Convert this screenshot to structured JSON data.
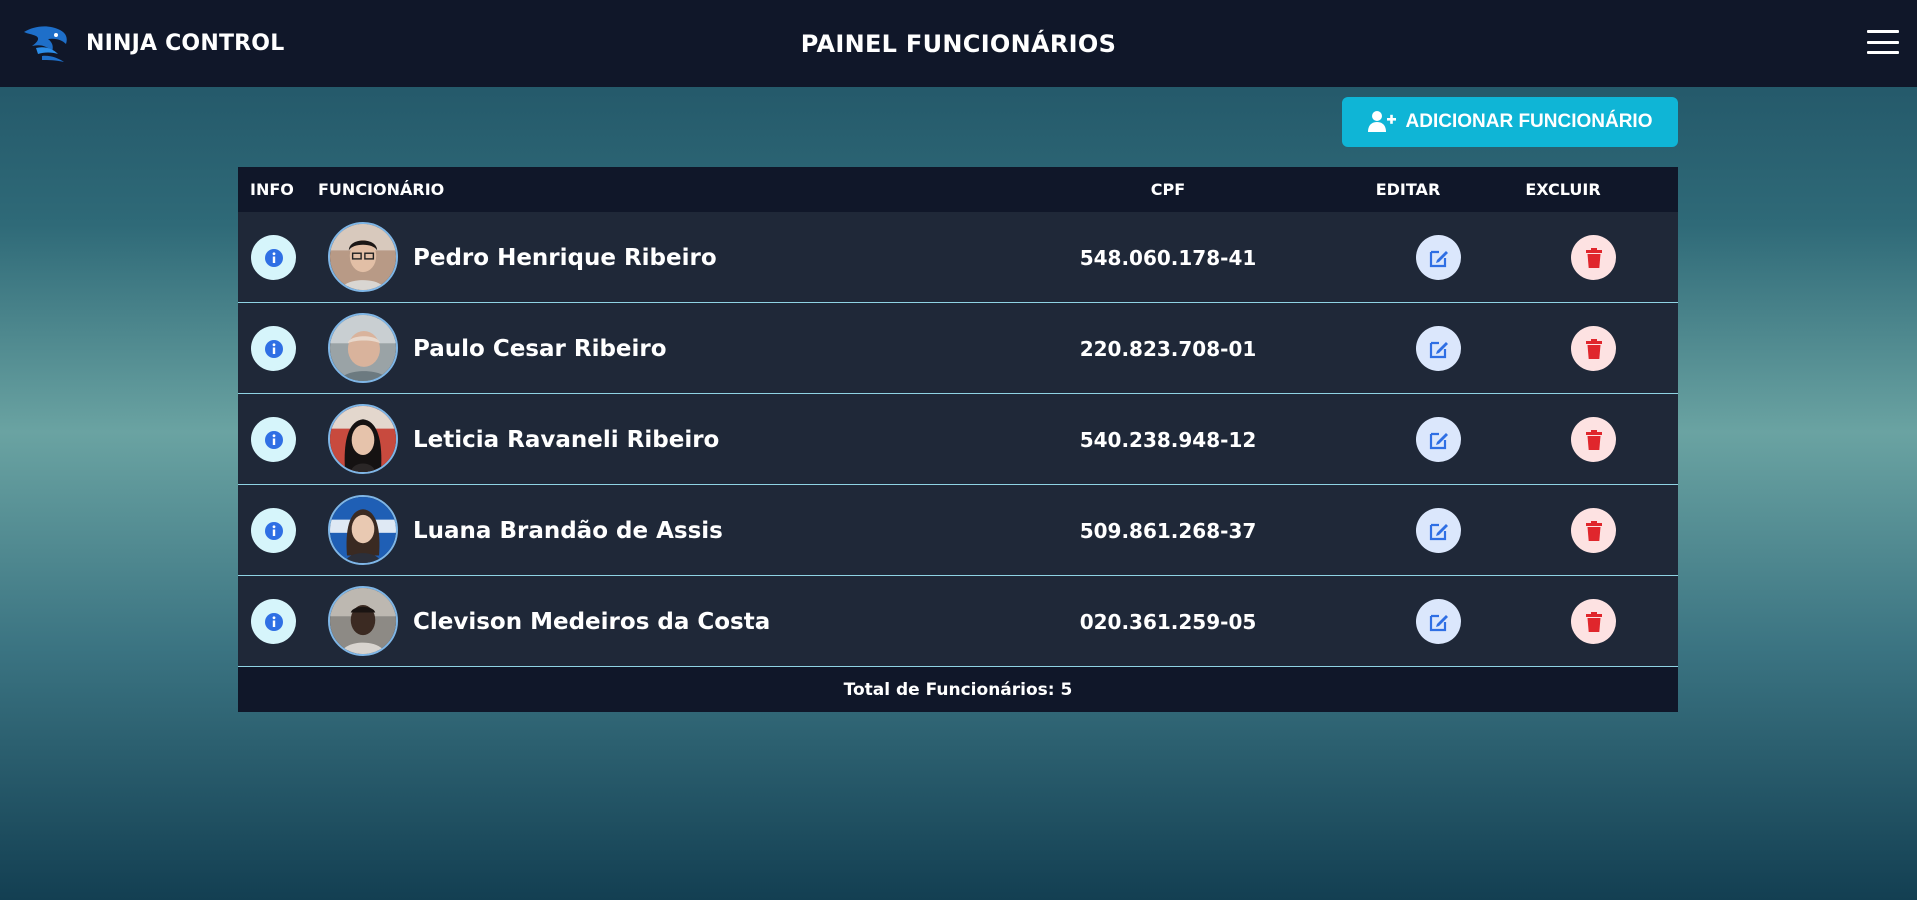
{
  "header": {
    "brand": "NINJA CONTROL",
    "brand_logo_icon": "ninja-logo-icon",
    "title": "PAINEL FUNCIONÁRIOS",
    "menu_icon": "hamburger-menu-icon"
  },
  "toolbar": {
    "add_label": "ADICIONAR FUNCIONÁRIO",
    "add_icon": "user-plus-icon",
    "add_color": "#0fb5d6"
  },
  "table": {
    "columns": {
      "info": "INFO",
      "employee": "FUNCIONÁRIO",
      "cpf": "CPF",
      "edit": "EDITAR",
      "delete": "EXCLUIR"
    },
    "rows": [
      {
        "name": "Pedro Henrique Ribeiro",
        "cpf": "548.060.178-41"
      },
      {
        "name": "Paulo Cesar Ribeiro",
        "cpf": "220.823.708-01"
      },
      {
        "name": "Leticia Ravaneli Ribeiro",
        "cpf": "540.238.948-12"
      },
      {
        "name": "Luana Brandão de Assis",
        "cpf": "509.861.268-37"
      },
      {
        "name": "Clevison Medeiros da Costa",
        "cpf": "020.361.259-05"
      }
    ],
    "row_icons": {
      "info": "info-icon",
      "edit": "edit-icon",
      "delete": "trash-icon"
    },
    "footer": "Total de Funcionários: 5"
  },
  "colors": {
    "header_bg": "#101729",
    "row_bg": "#1f2838",
    "info_icon": "#2f6fe4",
    "edit_icon": "#2f6fe4",
    "delete_icon": "#e0262c"
  }
}
